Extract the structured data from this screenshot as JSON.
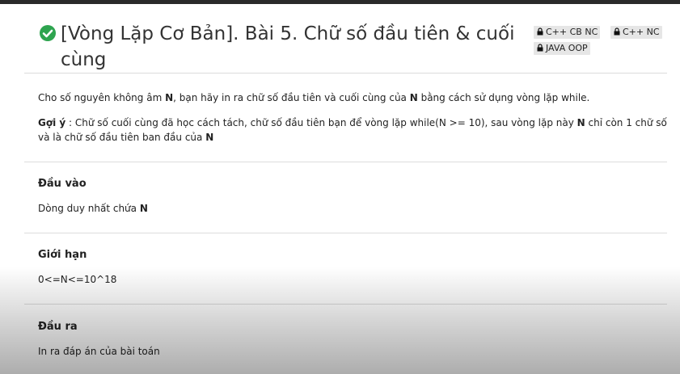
{
  "problem": {
    "title": "[Vòng Lặp Cơ Bản]. Bài 5. Chữ số đầu tiên & cuối cùng",
    "status_color": "#2ea44f"
  },
  "tags": [
    "C++ CB NC",
    "C++ NC",
    "JAVA OOP"
  ],
  "statement": {
    "intro_before": "Cho số nguyên không âm ",
    "intro_var": "N",
    "intro_middle": ", bạn hãy in ra chữ số đầu tiên và cuối cùng của ",
    "intro_var2": "N",
    "intro_after": " bằng cách sử dụng vòng lặp while.",
    "hint_label": "Gợi ý",
    "hint_text": " : Chữ số cuối cùng đã học cách tách, chữ số đầu tiên bạn để vòng lặp while(N >= 10), sau vòng lặp này ",
    "hint_var": "N",
    "hint_text2": " chỉ còn 1 chữ số và là chữ số đầu tiên ban đầu của ",
    "hint_var2": "N"
  },
  "sections": {
    "input_title": "Đầu vào",
    "input_text": "Dòng duy nhất chứa ",
    "input_var": "N",
    "limit_title": "Giới hạn",
    "limit_text": "0<=N<=10^18",
    "output_title": "Đầu ra",
    "output_text": "In ra đáp án của bài toán"
  }
}
